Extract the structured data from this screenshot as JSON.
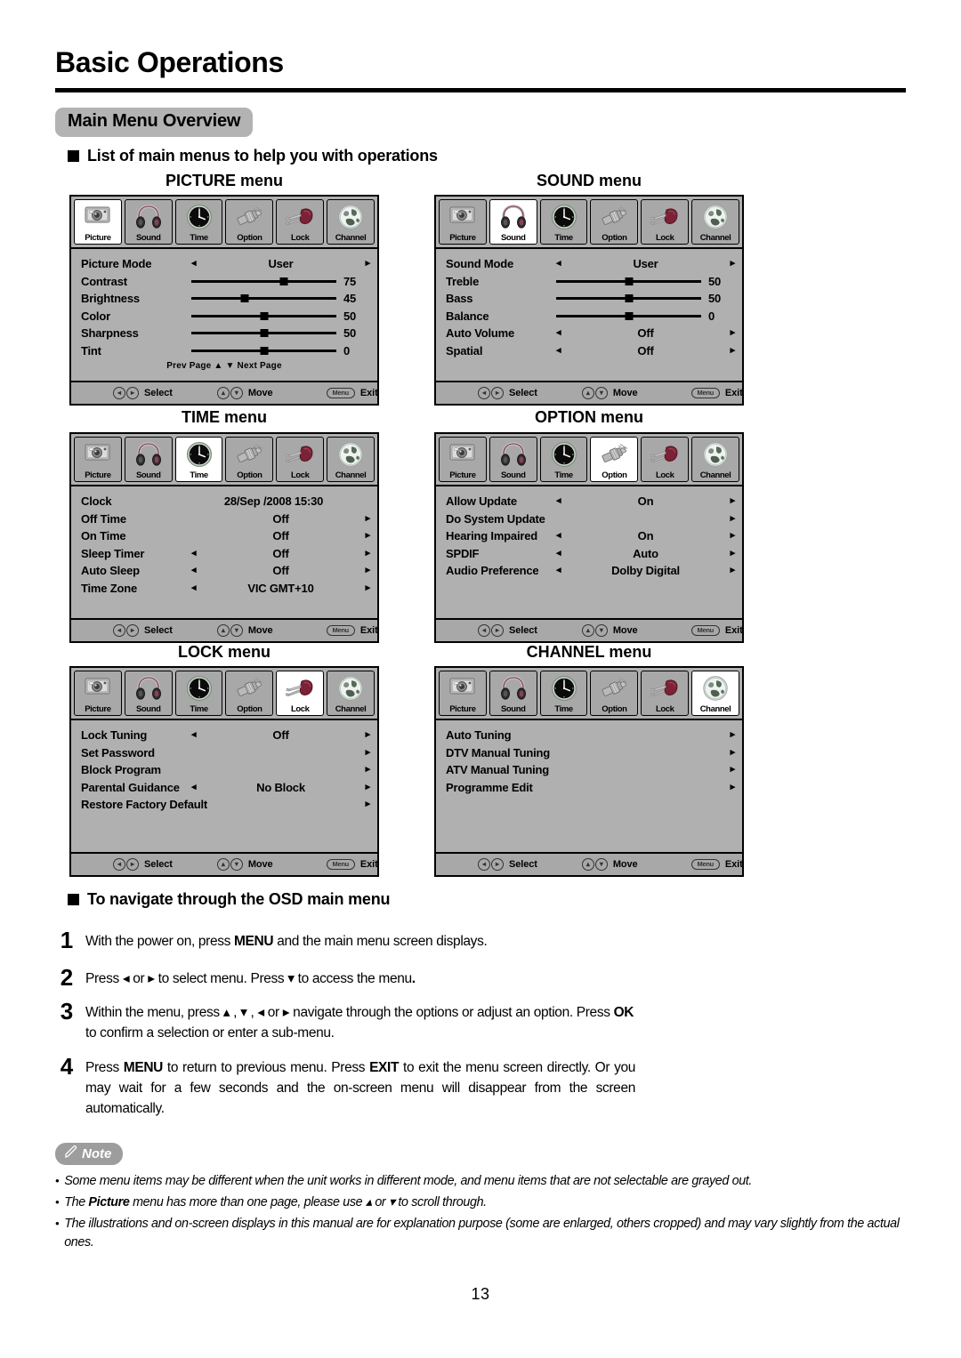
{
  "header": {
    "page_title": "Basic Operations",
    "section_badge": "Main Menu Overview",
    "list_heading": "List of main menus to help you with operations",
    "nav_heading": "To navigate through the OSD main menu"
  },
  "tabs_common": [
    {
      "key": "picture",
      "label": "Picture",
      "icon": "camera-icon"
    },
    {
      "key": "sound",
      "label": "Sound",
      "icon": "headphones-icon"
    },
    {
      "key": "time",
      "label": "Time",
      "icon": "clock-icon"
    },
    {
      "key": "option",
      "label": "Option",
      "icon": "connector-icon"
    },
    {
      "key": "lock",
      "label": "Lock",
      "icon": "keys-icon"
    },
    {
      "key": "channel",
      "label": "Channel",
      "icon": "globe-icon"
    }
  ],
  "footer": {
    "select_label": "Select",
    "move_label": "Move",
    "exit_label": "Exit",
    "menu_key_label": "Menu",
    "left_glyph": "◂",
    "right_glyph": "▸",
    "up_glyph": "▴",
    "down_glyph": "▾"
  },
  "menus": [
    {
      "title": "PICTURE menu",
      "active": "picture",
      "page_hint": "Prev  Page ▲   ▼ Next  Page",
      "rows": [
        {
          "label": "Picture Mode",
          "type": "option",
          "value": "User",
          "left": true,
          "right": true
        },
        {
          "label": "Contrast",
          "type": "slider",
          "value": "75",
          "pct": 64
        },
        {
          "label": "Brightness",
          "type": "slider",
          "value": "45",
          "pct": 37
        },
        {
          "label": "Color",
          "type": "slider",
          "value": "50",
          "pct": 50
        },
        {
          "label": "Sharpness",
          "type": "slider",
          "value": "50",
          "pct": 50
        },
        {
          "label": "Tint",
          "type": "slider",
          "value": "0",
          "pct": 50
        }
      ]
    },
    {
      "title": "SOUND menu",
      "active": "sound",
      "page_hint": "",
      "rows": [
        {
          "label": "Sound Mode",
          "type": "option",
          "value": "User",
          "left": true,
          "right": true
        },
        {
          "label": "Treble",
          "type": "slider",
          "value": "50",
          "pct": 50
        },
        {
          "label": "Bass",
          "type": "slider",
          "value": "50",
          "pct": 50
        },
        {
          "label": "Balance",
          "type": "slider",
          "value": "0",
          "pct": 50
        },
        {
          "label": "Auto Volume",
          "type": "option",
          "value": "Off",
          "left": true,
          "right": true
        },
        {
          "label": "Spatial",
          "type": "option",
          "value": "Off",
          "left": true,
          "right": true
        }
      ]
    },
    {
      "title": "TIME menu",
      "active": "time",
      "page_hint": "",
      "rows": [
        {
          "label": "Clock",
          "type": "text",
          "value": "28/Sep  /2008 15:30",
          "left": false,
          "right": false
        },
        {
          "label": "Off Time",
          "type": "option",
          "value": "Off",
          "left": false,
          "right": true
        },
        {
          "label": "On Time",
          "type": "option",
          "value": "Off",
          "left": false,
          "right": true
        },
        {
          "label": "Sleep Timer",
          "type": "option",
          "value": "Off",
          "left": true,
          "right": true
        },
        {
          "label": "Auto Sleep",
          "type": "option",
          "value": "Off",
          "left": true,
          "right": true
        },
        {
          "label": "Time Zone",
          "type": "option",
          "value": "VIC GMT+10",
          "left": true,
          "right": true
        }
      ]
    },
    {
      "title": "OPTION menu",
      "active": "option",
      "page_hint": "",
      "rows": [
        {
          "label": "Allow Update",
          "type": "option",
          "value": "On",
          "left": true,
          "right": true
        },
        {
          "label": "Do System Update",
          "type": "option",
          "value": "",
          "left": false,
          "right": true
        },
        {
          "label": "Hearing Impaired",
          "type": "option",
          "value": "On",
          "left": true,
          "right": true
        },
        {
          "label": "SPDIF",
          "type": "option",
          "value": "Auto",
          "left": true,
          "right": true
        },
        {
          "label": "Audio Preference",
          "type": "option",
          "value": "Dolby Digital",
          "left": true,
          "right": true
        }
      ]
    },
    {
      "title": "LOCK menu",
      "active": "lock",
      "page_hint": "",
      "rows": [
        {
          "label": "Lock Tuning",
          "type": "option",
          "value": "Off",
          "left": true,
          "right": true
        },
        {
          "label": "Set Password",
          "type": "option",
          "value": "",
          "left": false,
          "right": true
        },
        {
          "label": "Block Program",
          "type": "option",
          "value": "",
          "left": false,
          "right": true
        },
        {
          "label": "Parental Guidance",
          "type": "option",
          "value": "No Block",
          "left": true,
          "right": true
        },
        {
          "label": "Restore Factory Default",
          "type": "option",
          "value": "",
          "left": false,
          "right": true
        }
      ]
    },
    {
      "title": "CHANNEL menu",
      "active": "channel",
      "page_hint": "",
      "rows": [
        {
          "label": "Auto Tuning",
          "type": "option",
          "value": "",
          "left": false,
          "right": true
        },
        {
          "label": "DTV Manual Tuning",
          "type": "option",
          "value": "",
          "left": false,
          "right": true
        },
        {
          "label": "ATV Manual Tuning",
          "type": "option",
          "value": "",
          "left": false,
          "right": true
        },
        {
          "label": "Programme Edit",
          "type": "option",
          "value": "",
          "left": false,
          "right": true
        }
      ]
    }
  ],
  "steps": [
    {
      "num": "1",
      "html": "With the power on, press <b>MENU</b> and the main menu screen displays."
    },
    {
      "num": "2",
      "html": "Press ◂ or ▸ to select menu.  Press ▾ to access the menu<b>.</b>"
    },
    {
      "num": "3",
      "html": "Within the menu, press ▴ , ▾ , ◂ or ▸ navigate through the options or adjust an option. Press <b>OK</b> to confirm a selection or enter a sub-menu."
    },
    {
      "num": "4",
      "html": "Press <b>MENU</b> to return to previous menu. Press <b>EXIT</b> to exit the menu screen directly. Or you may wait for a few seconds and the on-screen menu will disappear from the screen automatically."
    }
  ],
  "note": {
    "badge": "Note",
    "items": [
      "Some menu items may be different when the unit works in different mode, and menu items that are not selectable are grayed out.",
      "The <b>Picture</b> menu has more than one page, please use ▴ or ▾ to scroll through.",
      "The illustrations and on-screen displays in this manual are for explanation purpose (some are enlarged, others cropped) and may vary slightly from the actual ones."
    ]
  },
  "page_number": "13",
  "colors": {
    "osd_background": "#b0b0b0",
    "osd_tab_inactive": "#a8a8a8",
    "osd_tab_active": "#ffffff",
    "badge_gray": "#b3b3b3",
    "note_gray": "#9d9d9d"
  }
}
